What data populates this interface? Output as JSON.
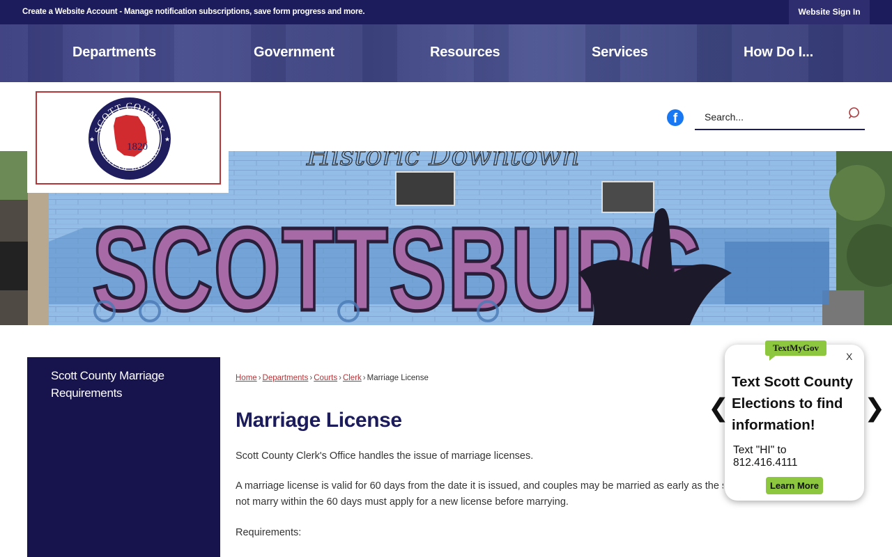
{
  "topbar": {
    "message": "Create a Website Account - Manage notification subscriptions, save form progress and more.",
    "signin_label": "Website Sign In"
  },
  "nav": {
    "items": [
      "Departments",
      "Government",
      "Resources",
      "Services",
      "How Do I..."
    ]
  },
  "logo": {
    "arc_top": "SCOTT COUNTY",
    "arc_bottom": "STATE OF INDIANA",
    "year": "1820"
  },
  "search": {
    "placeholder": "Search..."
  },
  "banner": {
    "script_text": "Historic Downtown",
    "mural_text": "SCOTTSBURG"
  },
  "sidebar": {
    "link": "Scott County Marriage Requirements"
  },
  "breadcrumb": {
    "items": [
      "Home",
      "Departments",
      "Courts",
      "Clerk"
    ],
    "current": "Marriage License",
    "separator": "›"
  },
  "main": {
    "title": "Marriage License",
    "para1": "Scott County Clerk's Office handles the issue of marriage licenses.",
    "para2": "A marriage license is valid for 60 days from the date it is issued, and couples may be married as early as the s",
    "para2_line2": "not marry within the 60 days must apply for a new license before marrying.",
    "para3": "Requirements:"
  },
  "popup": {
    "badge": "TextMyGov",
    "close": "X",
    "title": "Text Scott County Elections to find information!",
    "text": "Text \"HI\" to 812.416.4111",
    "button": "Learn More",
    "prev_arrow": "❮",
    "next_arrow": "❯"
  },
  "colors": {
    "navy": "#1c1b5c",
    "sidebar": "#17134d",
    "link_red": "#b53438",
    "accent_green": "#8dc63f",
    "facebook": "#1877f2"
  }
}
